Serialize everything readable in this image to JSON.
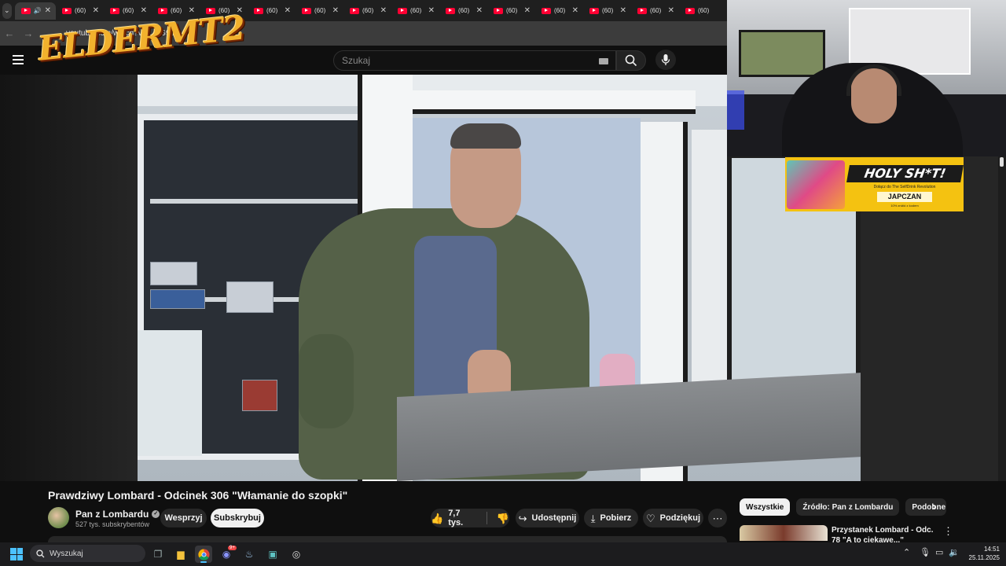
{
  "browser": {
    "tabs": [
      {
        "label": "(60)"
      },
      {
        "label": "(60)"
      },
      {
        "label": "(60)"
      },
      {
        "label": "(60)"
      },
      {
        "label": "(60)"
      },
      {
        "label": "(60)"
      },
      {
        "label": "(60)"
      },
      {
        "label": "(60)"
      },
      {
        "label": "(60)"
      },
      {
        "label": "(60)"
      },
      {
        "label": "(60)"
      },
      {
        "label": "(60)"
      },
      {
        "label": "(60)"
      },
      {
        "label": "(60)"
      }
    ],
    "url": "youtube.com/watch?v=…EG9Zk"
  },
  "overlay": {
    "logo_text": "ELDERMT2",
    "ad": {
      "title": "HOLY SH*T!",
      "subtitle": "Dołącz do The SelfDrink Revolution",
      "brand": "JAPCZAN",
      "note": "10% zniżki z kodem"
    }
  },
  "youtube": {
    "search_placeholder": "Szukaj",
    "video_title": "Prawdziwy Lombard - Odcinek 306 \"Włamanie do szopki\"",
    "channel": {
      "name": "Pan z Lombardu",
      "subscribers": "527 tys. subskrybentów"
    },
    "buttons": {
      "support": "Wesprzyj",
      "subscribe": "Subskrybuj",
      "likes": "7,7 tys.",
      "share": "Udostępnij",
      "download": "Pobierz",
      "thanks": "Podziękuj"
    },
    "chips": [
      "Wszystkie",
      "Źródło: Pan z Lombardu",
      "Podobne"
    ],
    "recommendation": {
      "title": "Przystanek Lombard - Odc. 78 \"A to ciekawe...\""
    }
  },
  "taskbar": {
    "search_placeholder": "Wyszukaj",
    "time": "14:51",
    "date": "25.11.2025",
    "discord_badge": "9+"
  }
}
